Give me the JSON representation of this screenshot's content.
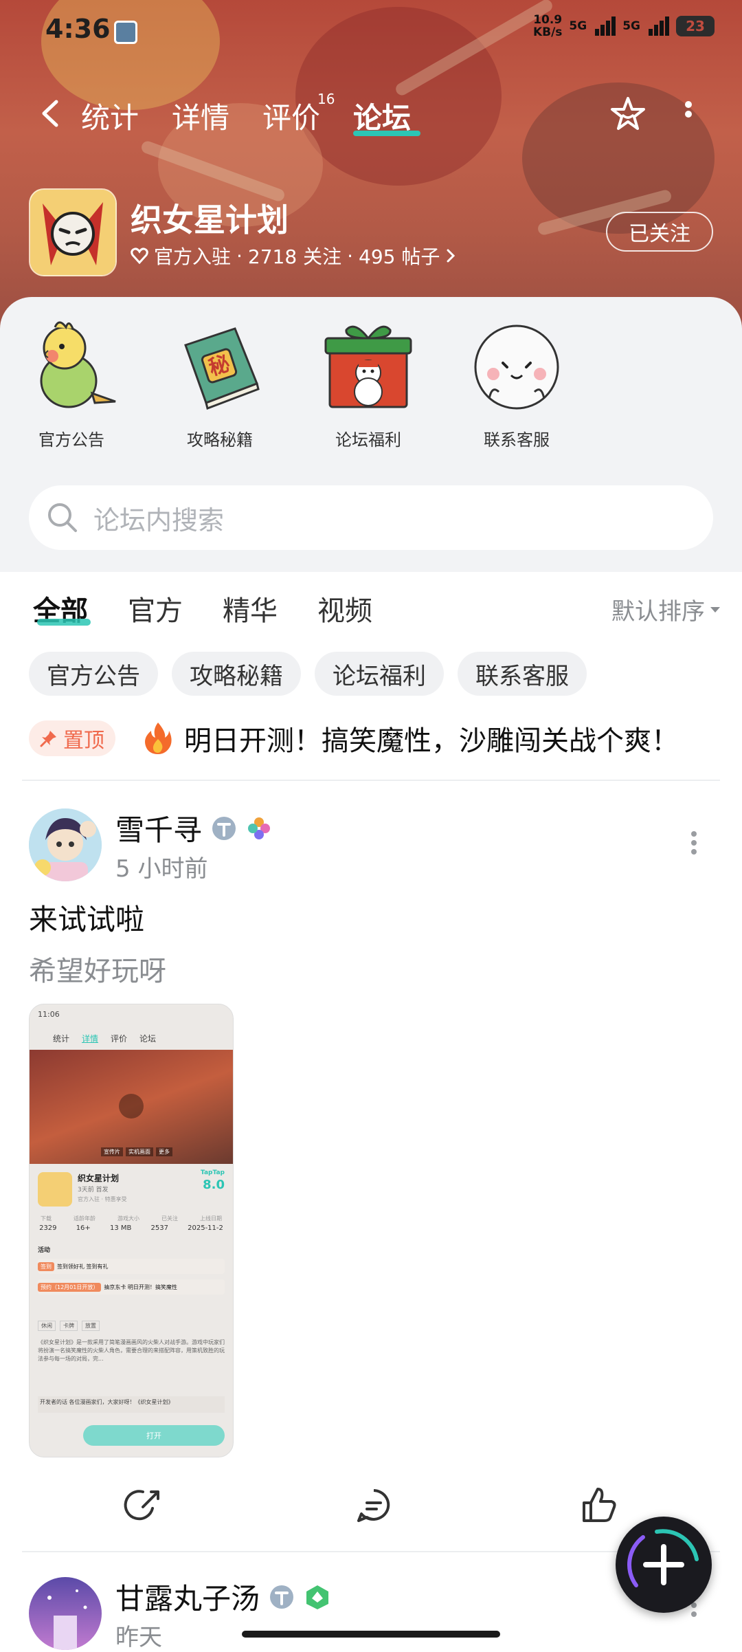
{
  "status_bar": {
    "time": "4:36",
    "net_speed_value": "10.9",
    "net_speed_unit": "KB/s",
    "sim1": "5G",
    "sim2": "5G",
    "battery": "23"
  },
  "nav": {
    "tabs": [
      {
        "label": "统计"
      },
      {
        "label": "详情"
      },
      {
        "label": "评价"
      },
      {
        "label": "论坛"
      }
    ],
    "review_count": "16",
    "active_tab": "论坛"
  },
  "game": {
    "title": "织女星计划",
    "meta_official": "官方入驻",
    "meta_sep": "·",
    "meta_follows": "2718 关注",
    "meta_posts": "495 帖子",
    "follow_label": "已关注"
  },
  "shortcuts": [
    {
      "label": "官方公告"
    },
    {
      "label": "攻略秘籍"
    },
    {
      "label": "论坛福利"
    },
    {
      "label": "联系客服"
    }
  ],
  "search": {
    "placeholder": "论坛内搜索"
  },
  "filters": {
    "tabs": [
      "全部",
      "官方",
      "精华",
      "视频"
    ],
    "sort_label": "默认排序"
  },
  "chips": [
    "官方公告",
    "攻略秘籍",
    "论坛福利",
    "联系客服"
  ],
  "pinned": {
    "badge": "置顶",
    "title": "明日开测！搞笑魔性，沙雕闯关战个爽！"
  },
  "posts": [
    {
      "author": "雪千寻",
      "time": "5 小时前",
      "title": "来试试啦",
      "body": "希望好玩呀"
    },
    {
      "author": "甘露丸子汤",
      "time": "昨天"
    }
  ],
  "screenshot_preview": {
    "time": "11:06",
    "tabs": [
      "统计",
      "详情",
      "评价",
      "论坛"
    ],
    "game_name": "织女星计划",
    "subtitle": "3天前 首发",
    "official": "官方入驻 · 特惠享受",
    "score_brand": "TapTap",
    "score": "8.0",
    "stats_labels": [
      "下载",
      "适龄年龄",
      "游戏大小",
      "已关注",
      "上线日期"
    ],
    "stats_values": [
      "2329",
      "16+",
      "13 MB",
      "2537",
      "2025-11-2"
    ],
    "activity": "活动",
    "sign_badge": "签到",
    "sign_text": "签到领好礼 签到有礼",
    "reserve_badge": "预约（12月01日开放）",
    "reserve_text": "抽京东卡 明日开测！搞笑魔性",
    "tags": [
      "休闲",
      "卡牌",
      "放置"
    ],
    "desc": "《织女星计划》是一款采用了简笔漫画画风的火柴人对战手游。游戏中玩家们将扮演一名搞笑魔性的火柴人角色，需要合理的来搭配阵容，用策机致胜的玩法参与每一场的对局，完...",
    "dev": "开发者的话 各位漫画家们，大家好呀！《织女星计划》",
    "open_btn": "打开",
    "video_tabs": [
      "宣传片",
      "实机画面",
      "更多"
    ]
  },
  "colors": {
    "accent": "#2cc5b4",
    "pin": "#f06a4d",
    "hero": "#b5493a"
  },
  "icons": [
    "back-icon",
    "star-icon",
    "more-icon",
    "heart-icon",
    "chevron-right-icon",
    "search-icon",
    "caret-down-icon",
    "pin-icon",
    "fire-icon",
    "share-icon",
    "comment-icon",
    "like-icon",
    "plus-icon"
  ]
}
